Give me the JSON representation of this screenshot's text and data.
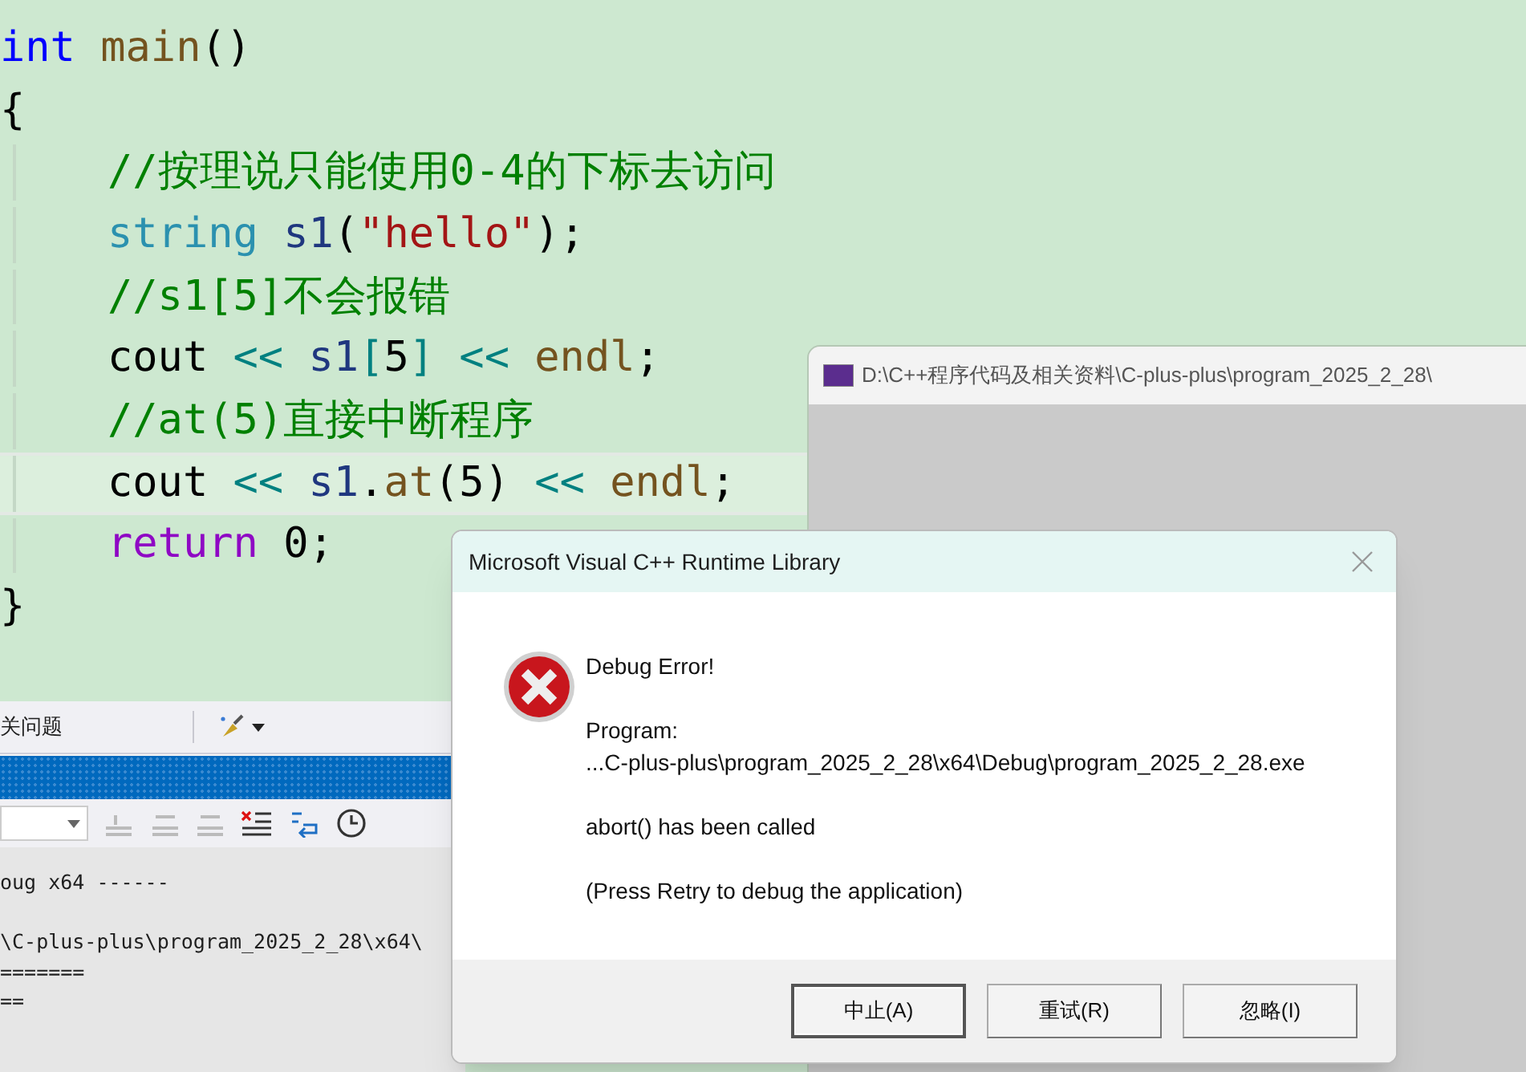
{
  "editor": {
    "lines": [
      {
        "indented": false,
        "current": false,
        "tokens": [
          {
            "text": "int",
            "kind": "keyword"
          },
          {
            "text": " main",
            "kind": "function"
          },
          {
            "text": "()",
            "kind": "plain"
          }
        ]
      },
      {
        "indented": false,
        "current": false,
        "tokens": [
          {
            "text": "{",
            "kind": "plain"
          }
        ]
      },
      {
        "indented": true,
        "current": false,
        "tokens": [
          {
            "text": "//按理说只能使用0-4的下标去访问",
            "kind": "comment"
          }
        ]
      },
      {
        "indented": true,
        "current": false,
        "tokens": [
          {
            "text": "string",
            "kind": "type"
          },
          {
            "text": " s1",
            "kind": "variable"
          },
          {
            "text": "(",
            "kind": "plain"
          },
          {
            "text": "\"hello\"",
            "kind": "string"
          },
          {
            "text": ");",
            "kind": "plain"
          }
        ]
      },
      {
        "indented": true,
        "current": false,
        "tokens": [
          {
            "text": "//s1[5]不会报错",
            "kind": "comment"
          }
        ]
      },
      {
        "indented": true,
        "current": false,
        "tokens": [
          {
            "text": "cout",
            "kind": "plain"
          },
          {
            "text": " <<",
            "kind": "operator"
          },
          {
            "text": " s1",
            "kind": "variable"
          },
          {
            "text": "[",
            "kind": "operator"
          },
          {
            "text": "5",
            "kind": "plain"
          },
          {
            "text": "]",
            "kind": "operator"
          },
          {
            "text": " <<",
            "kind": "operator"
          },
          {
            "text": " endl",
            "kind": "function"
          },
          {
            "text": ";",
            "kind": "plain"
          }
        ]
      },
      {
        "indented": true,
        "current": false,
        "tokens": [
          {
            "text": "//at(5)直接中断程序",
            "kind": "comment"
          }
        ]
      },
      {
        "indented": true,
        "current": true,
        "tokens": [
          {
            "text": "cout",
            "kind": "plain"
          },
          {
            "text": " <<",
            "kind": "operator"
          },
          {
            "text": " s1",
            "kind": "variable"
          },
          {
            "text": ".",
            "kind": "plain"
          },
          {
            "text": "at",
            "kind": "function"
          },
          {
            "text": "(5)",
            "kind": "plain"
          },
          {
            "text": " <<",
            "kind": "operator"
          },
          {
            "text": " endl",
            "kind": "function"
          },
          {
            "text": ";",
            "kind": "plain"
          }
        ]
      },
      {
        "indented": true,
        "current": false,
        "tokens": [
          {
            "text": "return",
            "kind": "control"
          },
          {
            "text": " 0;",
            "kind": "plain"
          }
        ]
      },
      {
        "indented": false,
        "current": false,
        "tokens": [
          {
            "text": "}",
            "kind": "plain"
          }
        ]
      }
    ]
  },
  "output_panel": {
    "tab": "关问题",
    "output_lines": [
      {
        "text": "oug x64 ------",
        "blank_before": false
      },
      {
        "text": "\\C-plus-plus\\program_2025_2_28\\x64\\",
        "blank_before": true
      },
      {
        "text": "=======",
        "blank_before": false
      },
      {
        "text": "==",
        "blank_before": false
      }
    ]
  },
  "console_window": {
    "title": "D:\\C++程序代码及相关资料\\C-plus-plus\\program_2025_2_28\\"
  },
  "dialog": {
    "title": "Microsoft Visual C++ Runtime Library",
    "heading": "Debug Error!",
    "program_label": "Program:",
    "program_path": "...C-plus-plus\\program_2025_2_28\\x64\\Debug\\program_2025_2_28.exe",
    "message": "abort() has been called",
    "hint": "(Press Retry to debug the application)",
    "buttons": [
      {
        "label": "中止(A)",
        "selected": true
      },
      {
        "label": "重试(R)",
        "selected": false
      },
      {
        "label": "忽略(I)",
        "selected": false
      }
    ]
  }
}
